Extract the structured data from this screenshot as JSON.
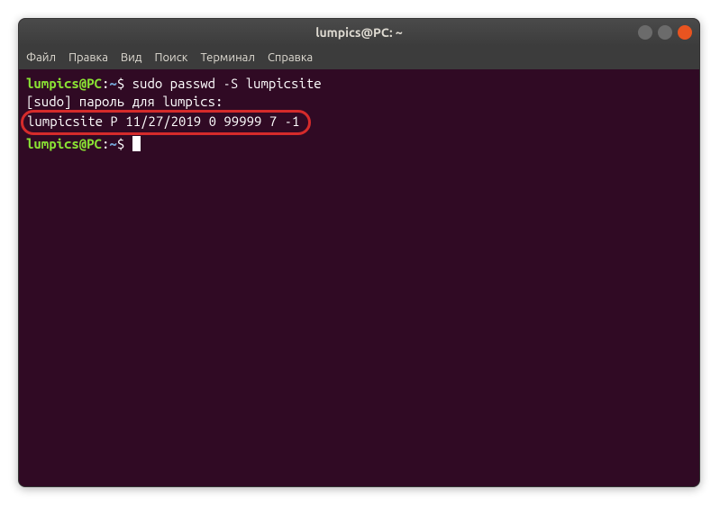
{
  "window": {
    "title": "lumpics@PC: ~"
  },
  "menu": {
    "file": "Файл",
    "edit": "Правка",
    "view": "Вид",
    "search": "Поиск",
    "terminal": "Терминал",
    "help": "Справка"
  },
  "prompt": {
    "user_host": "lumpics@PC",
    "colon": ":",
    "path": "~",
    "symbol": "$"
  },
  "terminal": {
    "line1_command": "sudo passwd -S lumpicsite",
    "line2": "[sudo] пароль для lumpics:",
    "line3": "lumpicsite P 11/27/2019 0 99999 7 -1"
  }
}
